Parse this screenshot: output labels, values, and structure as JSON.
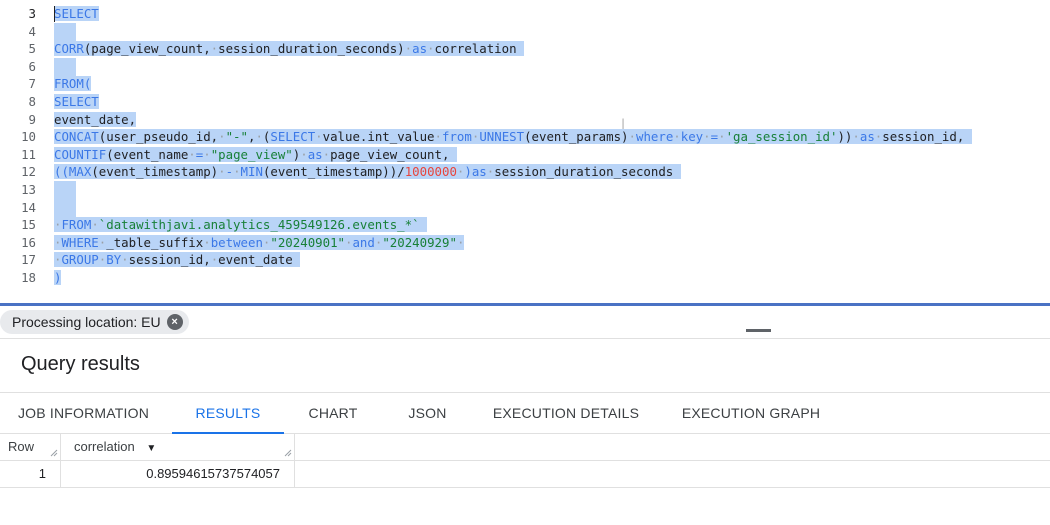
{
  "editor": {
    "lines": [
      {
        "num": "3",
        "tokens": [
          {
            "t": "SELECT",
            "c": "kw"
          }
        ]
      },
      {
        "num": "4",
        "tokens": []
      },
      {
        "num": "5",
        "tokens": [
          {
            "t": "CORR",
            "c": "fn"
          },
          {
            "t": "(page_view_count,",
            "c": "txt"
          },
          {
            "t": "·",
            "c": "op"
          },
          {
            "t": "session_duration_seconds)",
            "c": "txt"
          },
          {
            "t": "·",
            "c": "op"
          },
          {
            "t": "as",
            "c": "kw"
          },
          {
            "t": "·",
            "c": "op"
          },
          {
            "t": "correlation",
            "c": "txt"
          },
          {
            "t": " ",
            "c": "txt"
          }
        ]
      },
      {
        "num": "6",
        "tokens": []
      },
      {
        "num": "7",
        "tokens": [
          {
            "t": "FROM(",
            "c": "kw"
          }
        ]
      },
      {
        "num": "8",
        "tokens": [
          {
            "t": "SELECT",
            "c": "kw"
          }
        ]
      },
      {
        "num": "9",
        "tokens": [
          {
            "t": "event_date,",
            "c": "txt"
          }
        ]
      },
      {
        "num": "10",
        "tokens": [
          {
            "t": "CONCAT",
            "c": "fn"
          },
          {
            "t": "(user_pseudo_id,",
            "c": "txt"
          },
          {
            "t": "·",
            "c": "op"
          },
          {
            "t": "\"-\"",
            "c": "str"
          },
          {
            "t": ",",
            "c": "txt"
          },
          {
            "t": "·",
            "c": "op"
          },
          {
            "t": "(",
            "c": "txt"
          },
          {
            "t": "SELECT",
            "c": "kw"
          },
          {
            "t": "·",
            "c": "op"
          },
          {
            "t": "value.int_value",
            "c": "txt"
          },
          {
            "t": "·",
            "c": "op"
          },
          {
            "t": "from",
            "c": "kw"
          },
          {
            "t": "·",
            "c": "op"
          },
          {
            "t": "UNNEST",
            "c": "fn"
          },
          {
            "t": "(event_params)",
            "c": "txt"
          },
          {
            "t": "·",
            "c": "op"
          },
          {
            "t": "where",
            "c": "kw"
          },
          {
            "t": "·",
            "c": "op"
          },
          {
            "t": "key",
            "c": "kw"
          },
          {
            "t": "·",
            "c": "op"
          },
          {
            "t": "=",
            "c": "kw"
          },
          {
            "t": "·",
            "c": "op"
          },
          {
            "t": "'ga_session_id'",
            "c": "str"
          },
          {
            "t": "))",
            "c": "txt"
          },
          {
            "t": "·",
            "c": "op"
          },
          {
            "t": "as",
            "c": "kw"
          },
          {
            "t": "·",
            "c": "op"
          },
          {
            "t": "session_id,",
            "c": "txt"
          },
          {
            "t": " ",
            "c": "txt"
          }
        ]
      },
      {
        "num": "11",
        "tokens": [
          {
            "t": "COUNTIF",
            "c": "fn"
          },
          {
            "t": "(event_name",
            "c": "txt"
          },
          {
            "t": "·",
            "c": "op"
          },
          {
            "t": "=",
            "c": "kw"
          },
          {
            "t": "·",
            "c": "op"
          },
          {
            "t": "\"page_view\"",
            "c": "str"
          },
          {
            "t": ")",
            "c": "txt"
          },
          {
            "t": "·",
            "c": "op"
          },
          {
            "t": "as",
            "c": "kw"
          },
          {
            "t": "·",
            "c": "op"
          },
          {
            "t": "page_view_count,",
            "c": "txt"
          },
          {
            "t": " ",
            "c": "txt"
          }
        ]
      },
      {
        "num": "12",
        "tokens": [
          {
            "t": "((",
            "c": "kw"
          },
          {
            "t": "MAX",
            "c": "fn"
          },
          {
            "t": "(event_timestamp)",
            "c": "txt"
          },
          {
            "t": "·",
            "c": "op"
          },
          {
            "t": "-",
            "c": "kw"
          },
          {
            "t": "·",
            "c": "op"
          },
          {
            "t": "MIN",
            "c": "fn"
          },
          {
            "t": "(event_timestamp))/",
            "c": "txt"
          },
          {
            "t": "1000000",
            "c": "num"
          },
          {
            "t": "·",
            "c": "op"
          },
          {
            "t": ")as",
            "c": "kw"
          },
          {
            "t": "·",
            "c": "op"
          },
          {
            "t": "session_duration_seconds",
            "c": "txt"
          },
          {
            "t": " ",
            "c": "txt"
          }
        ]
      },
      {
        "num": "13",
        "tokens": []
      },
      {
        "num": "14",
        "tokens": []
      },
      {
        "num": "15",
        "tokens": [
          {
            "t": "·",
            "c": "op"
          },
          {
            "t": "FROM",
            "c": "kw"
          },
          {
            "t": "·",
            "c": "op"
          },
          {
            "t": "`datawithjavi.analytics_459549126.events_*`",
            "c": "str"
          },
          {
            "t": " ",
            "c": "txt"
          }
        ]
      },
      {
        "num": "16",
        "tokens": [
          {
            "t": "·",
            "c": "op"
          },
          {
            "t": "WHERE",
            "c": "kw"
          },
          {
            "t": "·",
            "c": "op"
          },
          {
            "t": "_table_suffix",
            "c": "txt"
          },
          {
            "t": "·",
            "c": "op"
          },
          {
            "t": "between",
            "c": "kw"
          },
          {
            "t": "·",
            "c": "op"
          },
          {
            "t": "\"20240901\"",
            "c": "str"
          },
          {
            "t": "·",
            "c": "op"
          },
          {
            "t": "and",
            "c": "kw"
          },
          {
            "t": "·",
            "c": "op"
          },
          {
            "t": "\"20240929\"",
            "c": "str"
          },
          {
            "t": "·",
            "c": "op"
          }
        ]
      },
      {
        "num": "17",
        "tokens": [
          {
            "t": "·",
            "c": "op"
          },
          {
            "t": "GROUP",
            "c": "kw"
          },
          {
            "t": "·",
            "c": "op"
          },
          {
            "t": "BY",
            "c": "kw"
          },
          {
            "t": "·",
            "c": "op"
          },
          {
            "t": "session_id,",
            "c": "txt"
          },
          {
            "t": "·",
            "c": "op"
          },
          {
            "t": "event_date",
            "c": "txt"
          },
          {
            "t": " ",
            "c": "txt"
          }
        ]
      },
      {
        "num": "18",
        "tokens": [
          {
            "t": ")",
            "c": "kw"
          }
        ]
      }
    ]
  },
  "processing": {
    "label": "Processing location: EU",
    "close_glyph": "×"
  },
  "results": {
    "title": "Query results",
    "tabs": [
      {
        "label": "JOB INFORMATION",
        "active": false
      },
      {
        "label": "RESULTS",
        "active": true
      },
      {
        "label": "CHART",
        "active": false
      },
      {
        "label": "JSON",
        "active": false
      },
      {
        "label": "EXECUTION DETAILS",
        "active": false
      },
      {
        "label": "EXECUTION GRAPH",
        "active": false
      }
    ],
    "columns": {
      "row": "Row",
      "correlation": "correlation",
      "sort_glyph": "▼"
    },
    "rows": [
      {
        "row": "1",
        "correlation": "0.89594615737574057"
      }
    ]
  },
  "colors": {
    "selection": "#b9d4f7",
    "keyword": "#3b78e7",
    "string": "#188038",
    "number": "#e8453c",
    "accent": "#1a73e8",
    "splitter": "#4a72c4"
  }
}
